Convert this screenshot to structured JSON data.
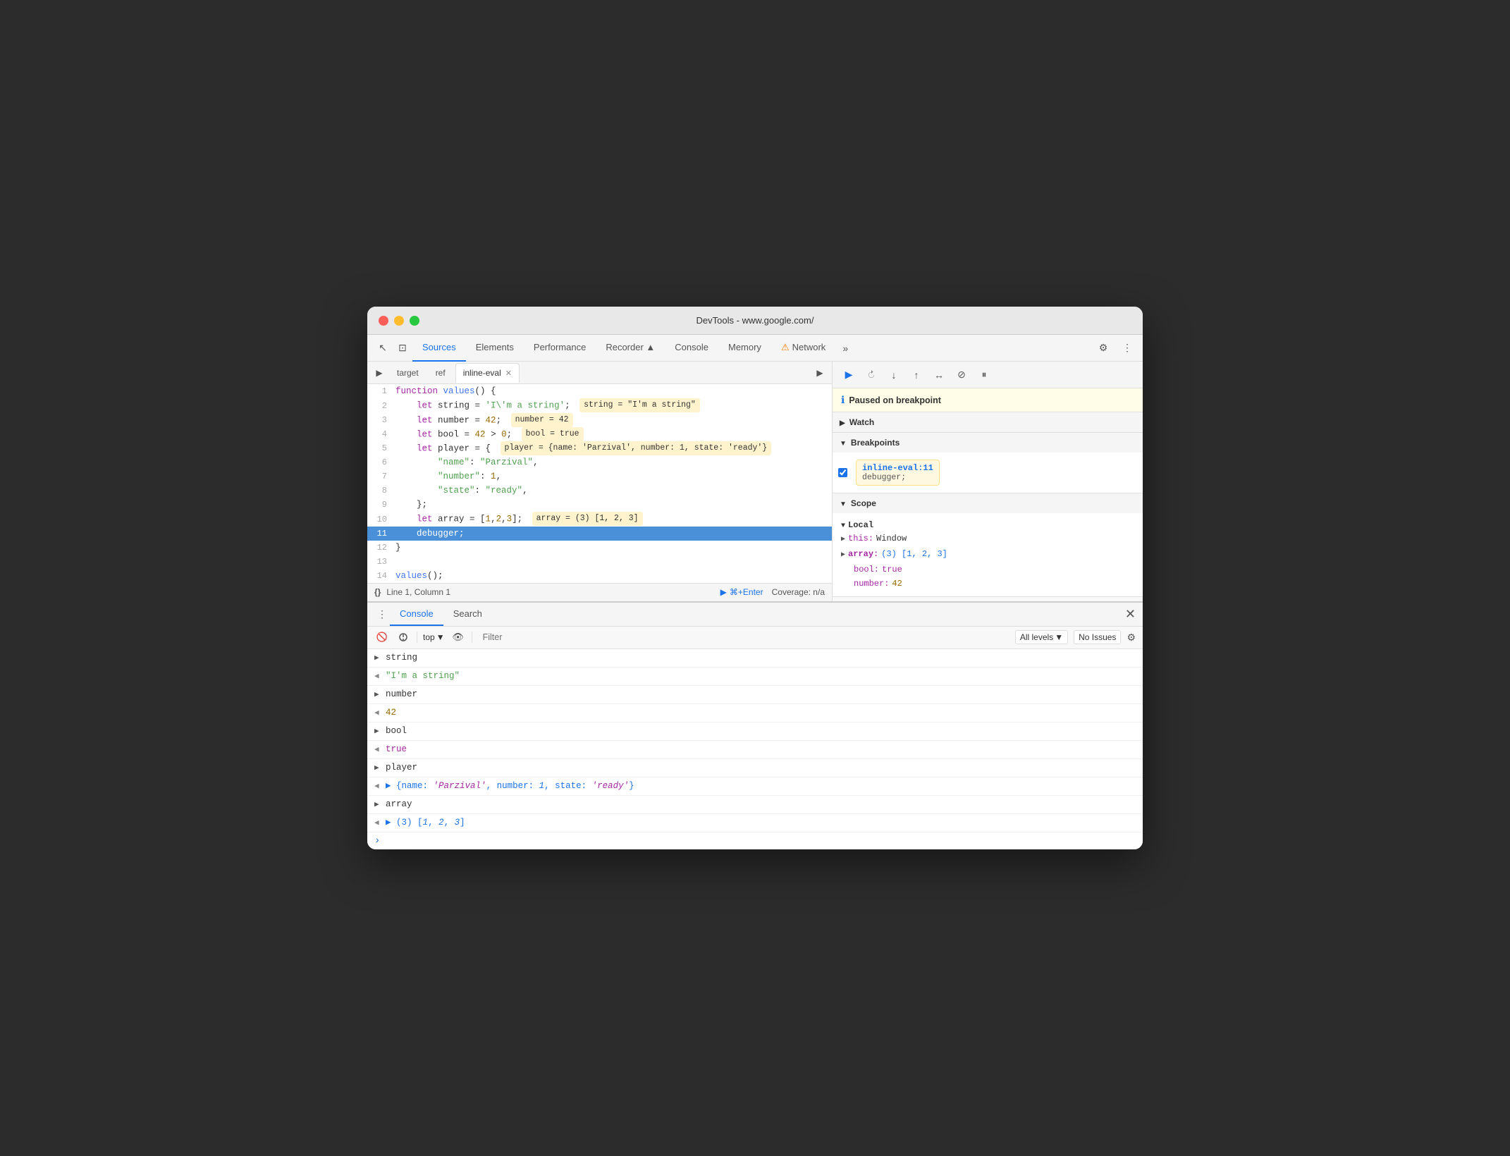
{
  "window": {
    "title": "DevTools - www.google.com/"
  },
  "window_controls": {
    "close": "●",
    "minimize": "●",
    "maximize": "●"
  },
  "tabs": [
    {
      "label": "Sources",
      "active": true
    },
    {
      "label": "Elements",
      "active": false
    },
    {
      "label": "Performance",
      "active": false
    },
    {
      "label": "Recorder ▲",
      "active": false
    },
    {
      "label": "Console",
      "active": false
    },
    {
      "label": "Memory",
      "active": false
    },
    {
      "label": "Network",
      "active": false
    }
  ],
  "source_tabs": [
    {
      "label": "target",
      "active": false,
      "closeable": false
    },
    {
      "label": "ref",
      "active": false,
      "closeable": false
    },
    {
      "label": "inline-eval",
      "active": true,
      "closeable": true
    }
  ],
  "code": {
    "lines": [
      {
        "num": 1,
        "content": "function values() {",
        "highlighted": false
      },
      {
        "num": 2,
        "content": "  let string = 'I\\'m a string';",
        "highlighted": false,
        "eval": "string = \"I'm a string\""
      },
      {
        "num": 3,
        "content": "  let number = 42;",
        "highlighted": false,
        "eval": "number = 42"
      },
      {
        "num": 4,
        "content": "  let bool = 42 > 0;",
        "highlighted": false,
        "eval": "bool = true"
      },
      {
        "num": 5,
        "content": "  let player = {  player = {name: 'Parzival', number: 1, state: 'ready'}",
        "highlighted": false
      },
      {
        "num": 6,
        "content": "    \"name\": \"Parzival\",",
        "highlighted": false
      },
      {
        "num": 7,
        "content": "    \"number\": 1,",
        "highlighted": false
      },
      {
        "num": 8,
        "content": "    \"state\": \"ready\",",
        "highlighted": false
      },
      {
        "num": 9,
        "content": "  };",
        "highlighted": false
      },
      {
        "num": 10,
        "content": "  let array = [1,2,3];",
        "highlighted": false,
        "eval": "array = (3) [1, 2, 3]"
      },
      {
        "num": 11,
        "content": "  debugger;",
        "highlighted": true
      },
      {
        "num": 12,
        "content": "}",
        "highlighted": false
      },
      {
        "num": 13,
        "content": "",
        "highlighted": false
      },
      {
        "num": 14,
        "content": "values();",
        "highlighted": false
      }
    ]
  },
  "status_bar": {
    "braces": "{}",
    "position": "Line 1, Column 1",
    "run_label": "⌘+Enter",
    "coverage": "Coverage: n/a"
  },
  "debugger": {
    "paused_message": "Paused on breakpoint",
    "watch_label": "Watch",
    "breakpoints_label": "Breakpoints",
    "scope_label": "Scope",
    "local_label": "Local",
    "breakpoint_file": "inline-eval:11",
    "breakpoint_code": "debugger;",
    "scope_items": [
      {
        "key": "this:",
        "value": "Window",
        "expandable": true,
        "color": "normal"
      },
      {
        "key": "array:",
        "value": "(3) [1, 2, 3]",
        "expandable": true,
        "color": "blue"
      },
      {
        "key": "bool:",
        "value": "true",
        "expandable": false,
        "color": "purple"
      },
      {
        "key": "number:",
        "value": "42",
        "expandable": false,
        "color": "num"
      }
    ]
  },
  "console": {
    "tabs": [
      {
        "label": "Console",
        "active": true
      },
      {
        "label": "Search",
        "active": false
      }
    ],
    "filter_placeholder": "Filter",
    "levels_label": "All levels ▼",
    "issues_label": "No Issues",
    "top_label": "top",
    "output": [
      {
        "arrow": "▶",
        "direction": "out",
        "text": "string",
        "color": "normal"
      },
      {
        "arrow": "◀",
        "direction": "in",
        "text": "\"I'm a string\"",
        "color": "string"
      },
      {
        "arrow": "▶",
        "direction": "out",
        "text": "number",
        "color": "normal"
      },
      {
        "arrow": "◀",
        "direction": "in",
        "text": "42",
        "color": "number"
      },
      {
        "arrow": "▶",
        "direction": "out",
        "text": "bool",
        "color": "normal"
      },
      {
        "arrow": "◀",
        "direction": "in",
        "text": "true",
        "color": "purple"
      },
      {
        "arrow": "▶",
        "direction": "out",
        "text": "player",
        "color": "normal"
      },
      {
        "arrow": "◀",
        "direction": "in",
        "text": "▶ {name: 'Parzival', number: 1, state: 'ready'}",
        "color": "blue"
      },
      {
        "arrow": "▶",
        "direction": "out",
        "text": "array",
        "color": "normal"
      },
      {
        "arrow": "◀",
        "direction": "in",
        "text": "▶ (3) [1, 2, 3]",
        "color": "blue"
      }
    ]
  },
  "icons": {
    "cursor": "↖",
    "layers": "⊞",
    "more": "»",
    "settings": "⚙",
    "ellipsis": "⋮",
    "play": "▶",
    "pause": "⏸",
    "step_over": "↷",
    "step_into": "↓",
    "step_out": "↑",
    "step_back": "↶",
    "deactivate": "⊘",
    "long_pause": "⏸",
    "chevron_right": "▶",
    "chevron_down": "▼",
    "info": "ℹ",
    "warning": "⚠",
    "eye": "👁",
    "block": "🚫",
    "gear": "⚙",
    "close": "✕"
  }
}
